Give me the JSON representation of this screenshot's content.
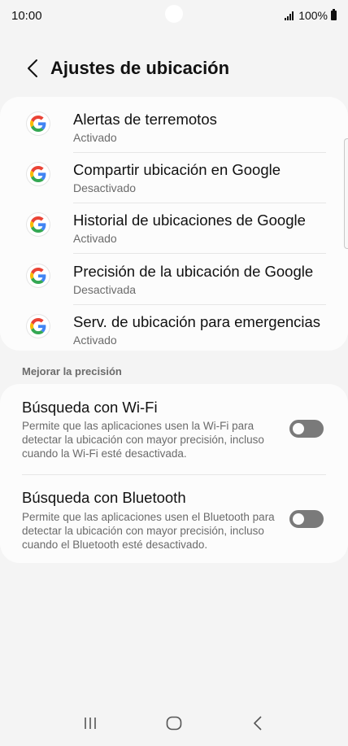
{
  "status_bar": {
    "time": "10:00",
    "battery": "100%",
    "icons": [
      "signal-icon",
      "battery-icon"
    ]
  },
  "header": {
    "title": "Ajustes de ubicación",
    "back_icon": "chevron-left-icon"
  },
  "google_services": [
    {
      "title": "Alertas de terremotos",
      "status": "Activado"
    },
    {
      "title": "Compartir ubicación en Google",
      "status": "Desactivado"
    },
    {
      "title": "Historial de ubicaciones de Google",
      "status": "Activado"
    },
    {
      "title": "Precisión de la ubicación de Google",
      "status": "Desactivada"
    },
    {
      "title": "Serv. de ubicación para emergencias",
      "status": "Activado"
    }
  ],
  "precision_section": {
    "header": "Mejorar la precisión",
    "items": [
      {
        "title": "Búsqueda con Wi-Fi",
        "description": "Permite que las aplicaciones usen la Wi-Fi para detectar la ubicación con mayor precisión, incluso cuando la Wi-Fi esté desactivada.",
        "enabled": false
      },
      {
        "title": "Búsqueda con Bluetooth",
        "description": "Permite que las aplicaciones usen el Bluetooth para detectar la ubicación con mayor precisión, incluso cuando el Bluetooth esté desactivado.",
        "enabled": false
      }
    ]
  },
  "nav_bar": {
    "buttons": [
      "recents-icon",
      "home-icon",
      "back-icon"
    ]
  },
  "colors": {
    "background": "#f4f4f4",
    "card": "#fcfcfc",
    "secondary_text": "#6b6b6b",
    "toggle_off": "#7a7a7a"
  }
}
